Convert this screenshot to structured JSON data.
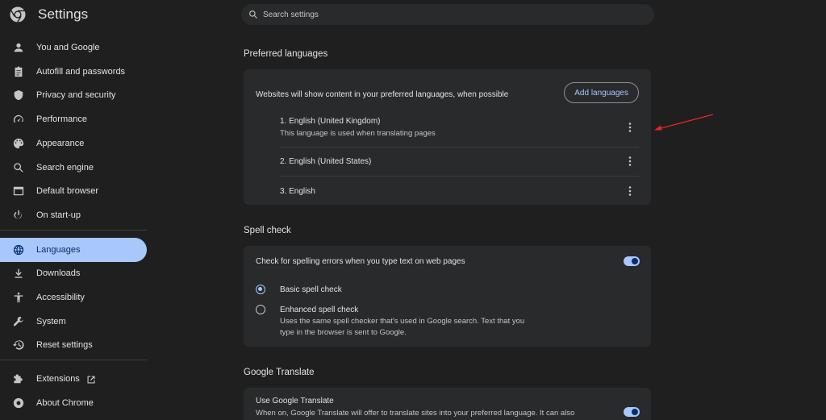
{
  "app": {
    "title": "Settings"
  },
  "sidebar": {
    "items": [
      {
        "label": "You and Google",
        "icon": "person-icon"
      },
      {
        "label": "Autofill and passwords",
        "icon": "clipboard-icon"
      },
      {
        "label": "Privacy and security",
        "icon": "shield-icon"
      },
      {
        "label": "Performance",
        "icon": "speedometer-icon"
      },
      {
        "label": "Appearance",
        "icon": "palette-icon"
      },
      {
        "label": "Search engine",
        "icon": "search-icon"
      },
      {
        "label": "Default browser",
        "icon": "browser-icon"
      },
      {
        "label": "On start-up",
        "icon": "power-icon"
      },
      {
        "label": "Languages",
        "icon": "globe-icon",
        "active": true
      },
      {
        "label": "Downloads",
        "icon": "download-icon"
      },
      {
        "label": "Accessibility",
        "icon": "accessibility-icon"
      },
      {
        "label": "System",
        "icon": "wrench-icon"
      },
      {
        "label": "Reset settings",
        "icon": "history-icon"
      },
      {
        "label": "Extensions",
        "icon": "puzzle-icon"
      },
      {
        "label": "About Chrome",
        "icon": "chrome-icon"
      }
    ]
  },
  "search": {
    "placeholder": "Search settings"
  },
  "preferred_languages": {
    "title": "Preferred languages",
    "description": "Websites will show content in your preferred languages, when possible",
    "add_button": "Add languages",
    "languages": [
      {
        "name": "1. English (United Kingdom)",
        "sub": "This language is used when translating pages"
      },
      {
        "name": "2. English (United States)"
      },
      {
        "name": "3. English"
      }
    ]
  },
  "spell_check": {
    "title": "Spell check",
    "toggle_label": "Check for spelling errors when you type text on web pages",
    "toggle_on": true,
    "options": [
      {
        "label": "Basic spell check",
        "checked": true
      },
      {
        "label": "Enhanced spell check",
        "sub_line1": "Uses the same spell checker that's used in Google search. Text that you",
        "sub_line2": "type in the browser is sent to Google.",
        "checked": false
      }
    ]
  },
  "google_translate": {
    "title": "Google Translate",
    "toggle_label": "Use Google Translate",
    "toggle_sub": "When on, Google Translate will offer to translate sites into your preferred language. It can also",
    "toggle_on": true
  },
  "colors": {
    "accent": "#a8c7fa",
    "background": "#1f1f1f",
    "card": "#282a2c",
    "annotation_arrow": "#e5252a"
  }
}
